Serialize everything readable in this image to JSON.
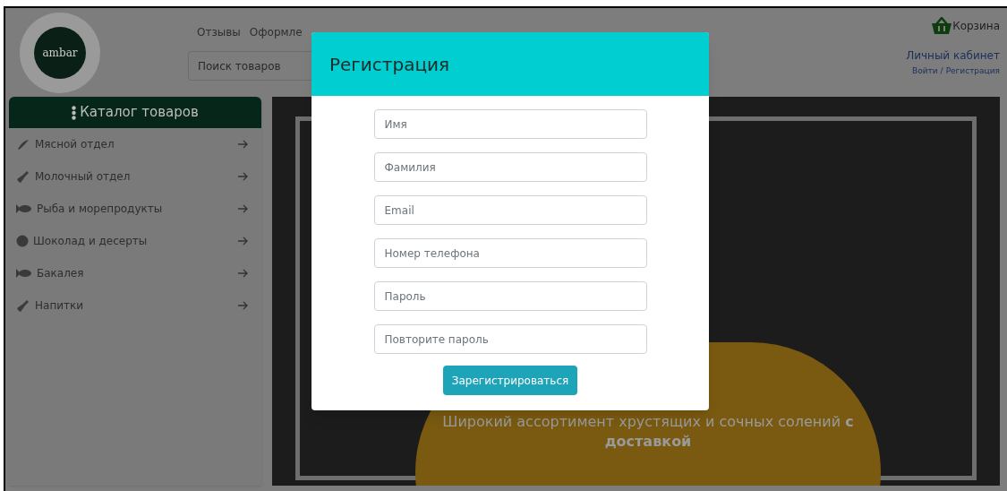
{
  "header": {
    "logo": "ambar",
    "nav": [
      "Отзывы",
      "Оформле"
    ],
    "search": {
      "placeholder": "Поиск товаров"
    },
    "cart": "Корзина",
    "account": {
      "title": "Личный кабинет",
      "login": "Войти",
      "separator": "/",
      "register": "Регистрация"
    }
  },
  "catalog": {
    "title": "Каталог товаров",
    "items": [
      {
        "label": "Мясной отдел",
        "kind": "meat"
      },
      {
        "label": "Молочный отдел",
        "kind": "bottle"
      },
      {
        "label": "Рыба и морепродукты",
        "kind": "fish"
      },
      {
        "label": "Шоколад и десерты",
        "kind": "cookie"
      },
      {
        "label": "Бакалея",
        "kind": "fish"
      },
      {
        "label": "Напитки",
        "kind": "bottle"
      }
    ]
  },
  "banner": {
    "text": "Широкий ассортимент хрустящих и сочных солений **с доставкой**"
  },
  "modal": {
    "title": "Регистрация",
    "fields": [
      {
        "placeholder": "Имя"
      },
      {
        "placeholder": "Фамилия"
      },
      {
        "placeholder": "Email"
      },
      {
        "placeholder": "Номер телефона"
      },
      {
        "placeholder": "Пароль"
      },
      {
        "placeholder": "Повторите пароль"
      }
    ],
    "submit": "Зарегистрироваться"
  }
}
